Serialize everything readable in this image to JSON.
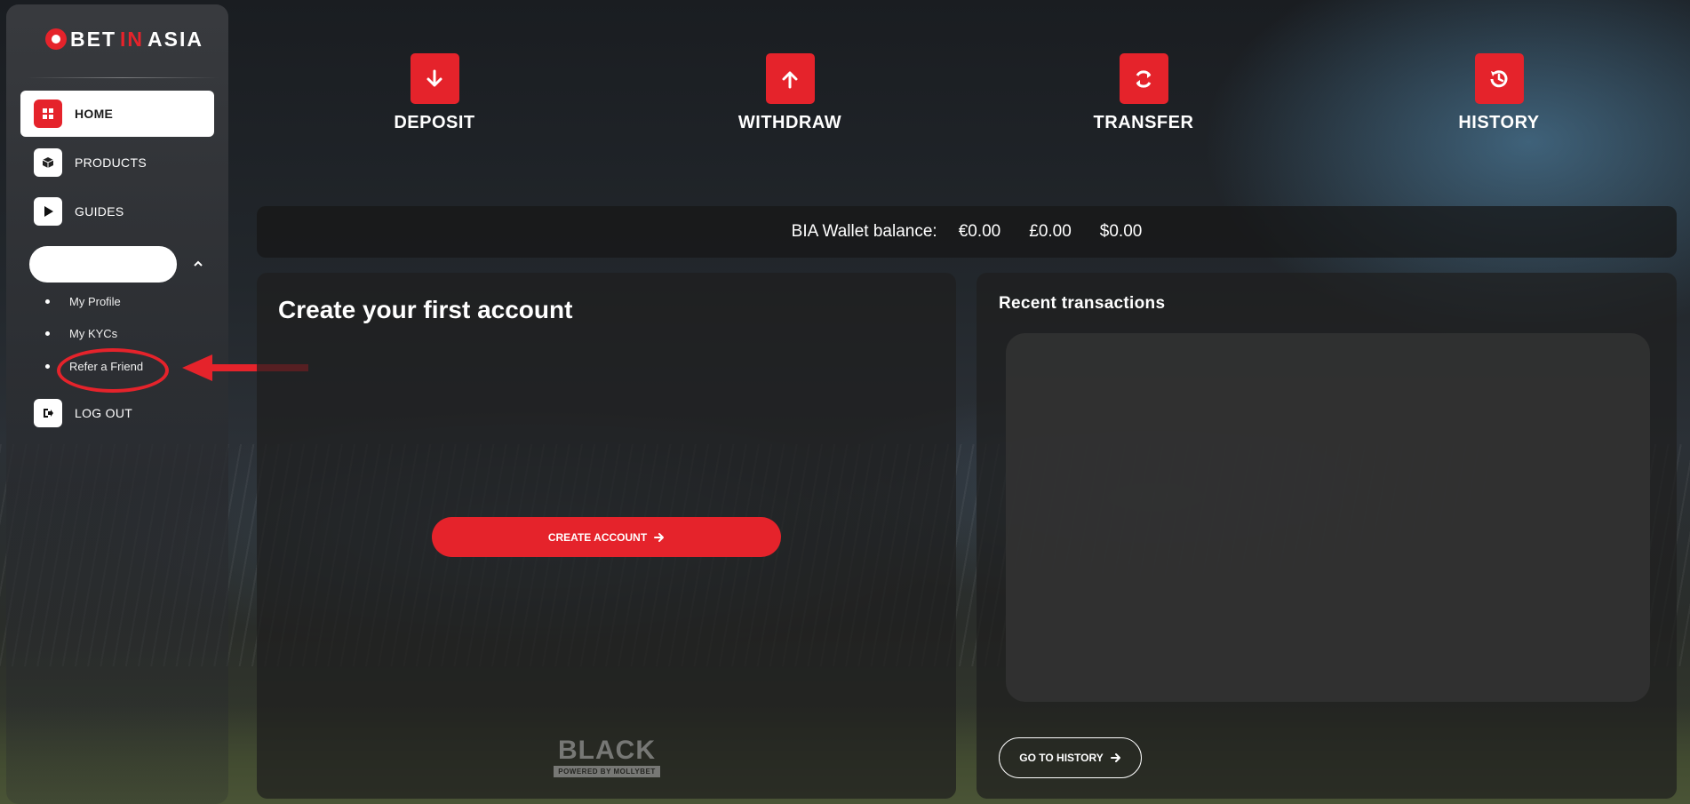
{
  "brand": {
    "part1": "BET",
    "part2": "IN",
    "part3": "ASIA",
    "accent": "#e5232b"
  },
  "nav": {
    "home": {
      "label": "HOME",
      "icon": "grid-icon"
    },
    "products": {
      "label": "PRODUCTS",
      "icon": "box-icon"
    },
    "guides": {
      "label": "GUIDES",
      "icon": "play-icon"
    },
    "logout": {
      "label": "LOG OUT",
      "icon": "logout-icon"
    }
  },
  "account_menu": {
    "items": [
      {
        "label": "My Profile"
      },
      {
        "label": "My KYCs"
      },
      {
        "label": "Refer a Friend"
      }
    ]
  },
  "actions": [
    {
      "label": "DEPOSIT",
      "icon": "arrow-down-icon"
    },
    {
      "label": "WITHDRAW",
      "icon": "arrow-up-icon"
    },
    {
      "label": "TRANSFER",
      "icon": "refresh-icon"
    },
    {
      "label": "HISTORY",
      "icon": "history-icon"
    }
  ],
  "wallet": {
    "label": "BIA Wallet balance:",
    "eur": "€0.00",
    "gbp": "£0.00",
    "usd": "$0.00"
  },
  "create_account": {
    "title": "Create your first account",
    "button_label": "CREATE ACCOUNT",
    "partner_logo": "BLACK",
    "partner_sub": "POWERED BY MOLLYBET"
  },
  "recent_transactions": {
    "title": "Recent transactions",
    "button_label": "GO TO HISTORY"
  }
}
